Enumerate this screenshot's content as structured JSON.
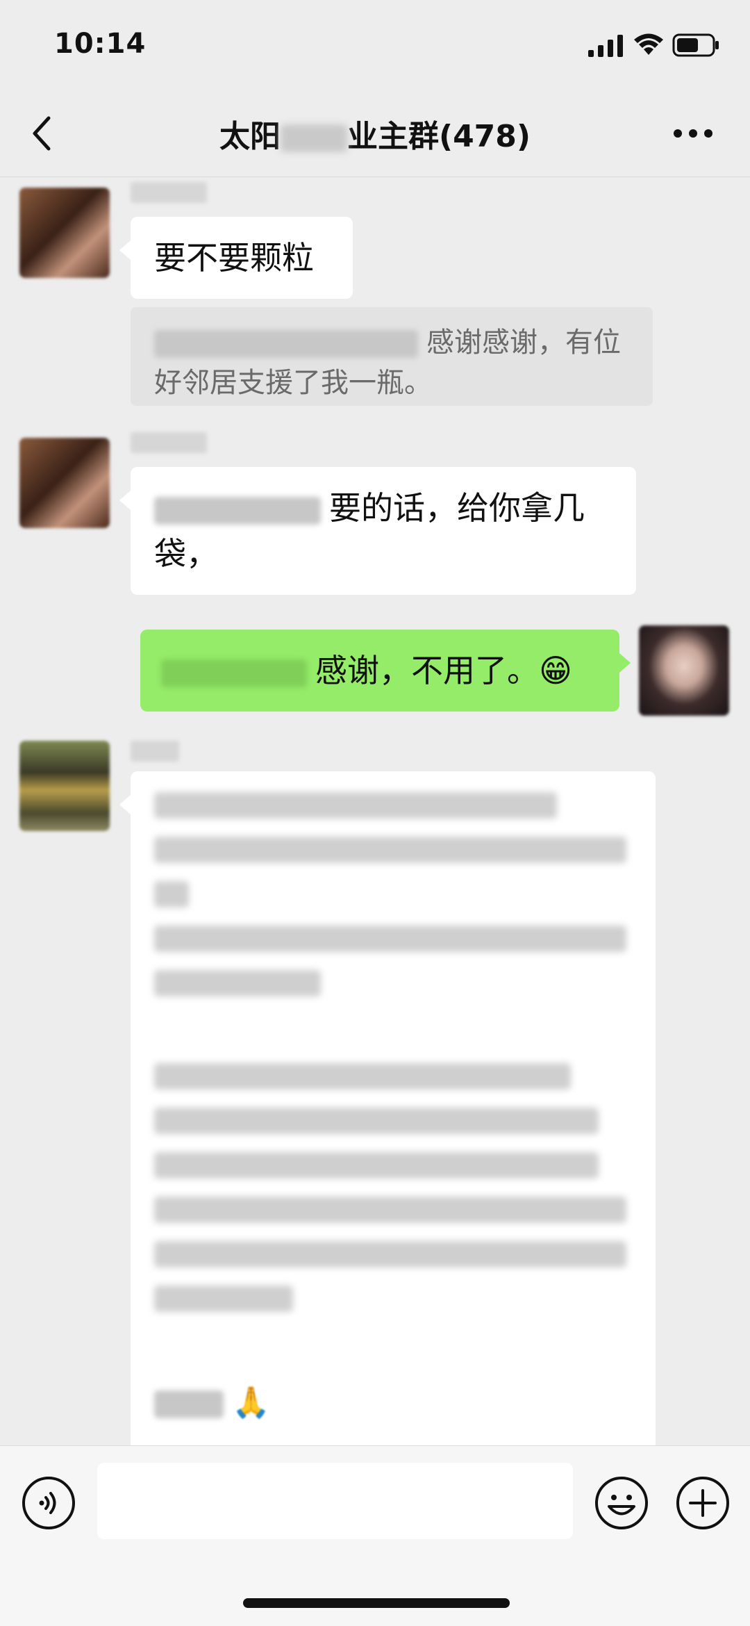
{
  "status_bar": {
    "time": "10:14",
    "signal_icon": "signal-bars-icon",
    "wifi_icon": "wifi-icon",
    "battery_icon": "battery-icon"
  },
  "nav": {
    "back_icon": "chevron-left-icon",
    "title_prefix": "太阳",
    "title_suffix": "业主群",
    "member_count": "(478)",
    "more_icon": "more-dots-icon"
  },
  "messages": [
    {
      "side": "left",
      "text": "要不要颗粒"
    },
    {
      "side": "left",
      "kind": "quote",
      "text_line1": "感谢感谢，有位",
      "text_line2": "好邻居支援了我一瓶。"
    },
    {
      "side": "left",
      "text_line1": "要的话，给你拿几",
      "text_line2": "袋，"
    },
    {
      "side": "right",
      "text": "感谢，不用了。",
      "emoji": "😁"
    },
    {
      "side": "left",
      "kind": "long-blurred",
      "emoji": "🙏"
    }
  ],
  "input_bar": {
    "voice_icon": "voice-input-icon",
    "input_placeholder": "",
    "emoji_icon": "emoji-icon",
    "plus_icon": "plus-icon"
  },
  "colors": {
    "background": "#ededed",
    "bubble_white": "#ffffff",
    "bubble_green": "#95ec69",
    "quote_bg": "#e3e3e3"
  }
}
